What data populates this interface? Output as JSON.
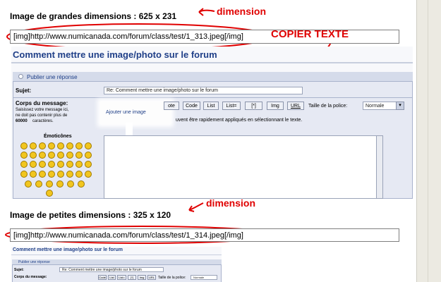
{
  "large": {
    "title": "Image de grandes dimensions : 625 x 231",
    "dimension_note": "dimension",
    "copy_note": "COPIER TEXTE",
    "code": "[img]http://www.numicanada.com/forum/class/test/1_313.jpeg[/img]",
    "forum_title": "Comment mettre une image/photo sur le forum",
    "post_reply": "Publier une réponse",
    "subject_label": "Sujet:",
    "subject_value": "Re: Comment mettre une image/photo sur le forum",
    "body_label": "Corps du message:",
    "body_help": [
      "Saisissez votre message ici,",
      "ne doit pas contenir plus de",
      "caractères."
    ],
    "body_limit": "60000",
    "add_image": "Ajouter une image",
    "toolbar": [
      "ote",
      "Code",
      "List",
      "List=",
      "[*]",
      "Img",
      "URL"
    ],
    "font_size_label": "Taille de la police:",
    "font_size_value": "Normale",
    "hint": "uvent être rapidement appliqués en sélectionnant le texte.",
    "emoticons_label": "Émoticônes"
  },
  "small": {
    "title": "Image de petites dimensions : 325 x 120",
    "dimension_note": "dimension",
    "code": "[img]http://www.numicanada.com/forum/class/test/1_314.jpeg[/img]",
    "forum_title": "Comment mettre une image/photo sur le forum",
    "post_reply": "Publier une réponse",
    "subject_label": "Sujet:",
    "subject_value": "Re: Comment mettre une image/photo sur le forum",
    "body_label": "Corps du message:",
    "toolbar": [
      "Code",
      "List",
      "List=",
      "[*]",
      "Img",
      "URL"
    ],
    "font_size_label": "Taille de la police:",
    "font_size_value": "Normale"
  },
  "colors": {
    "annotation_red": "#e00000",
    "forum_blue": "#1f3f88",
    "panel_bg": "#e6e9f3"
  }
}
